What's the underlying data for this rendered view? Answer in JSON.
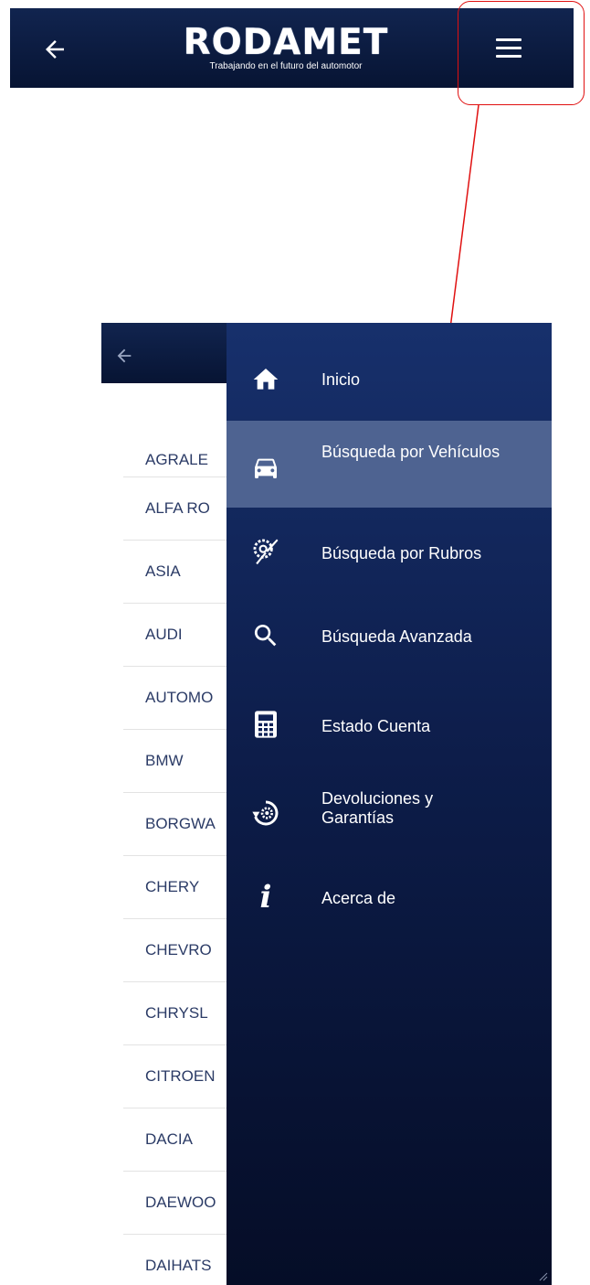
{
  "header": {
    "logo_text": "RODAMET",
    "tagline": "Trabajando en el futuro del automotor",
    "back_icon": "arrow-left-icon",
    "menu_icon": "hamburger-menu-icon"
  },
  "brands": [
    "AGRALE",
    "ALFA RO",
    "ASIA",
    "AUDI",
    "AUTOMO",
    "BMW",
    "BORGWA",
    "CHERY",
    "CHEVRO",
    "CHRYSL",
    "CITROEN",
    "DACIA",
    "DAEWOO",
    "DAIHATS"
  ],
  "drawer": {
    "items": [
      {
        "label": "Inicio",
        "icon": "home-icon"
      },
      {
        "label": "Búsqueda por Vehículos",
        "icon": "car-icon",
        "active": true
      },
      {
        "label": "Búsqueda por Rubros",
        "icon": "parts-icon"
      },
      {
        "label": "Búsqueda Avanzada",
        "icon": "search-icon"
      },
      {
        "label": "Estado Cuenta",
        "icon": "calculator-icon"
      },
      {
        "label": "Devoluciones y Garantías",
        "icon": "returns-icon"
      },
      {
        "label": "Acerca de",
        "icon": "info-icon"
      }
    ]
  },
  "colors": {
    "header_bg": "#0b1a40",
    "drawer_top": "#17306c",
    "drawer_bottom": "#050d27",
    "active_item": "#4e6391",
    "annotation": "#e01010",
    "brand_text": "#2b3b66"
  }
}
